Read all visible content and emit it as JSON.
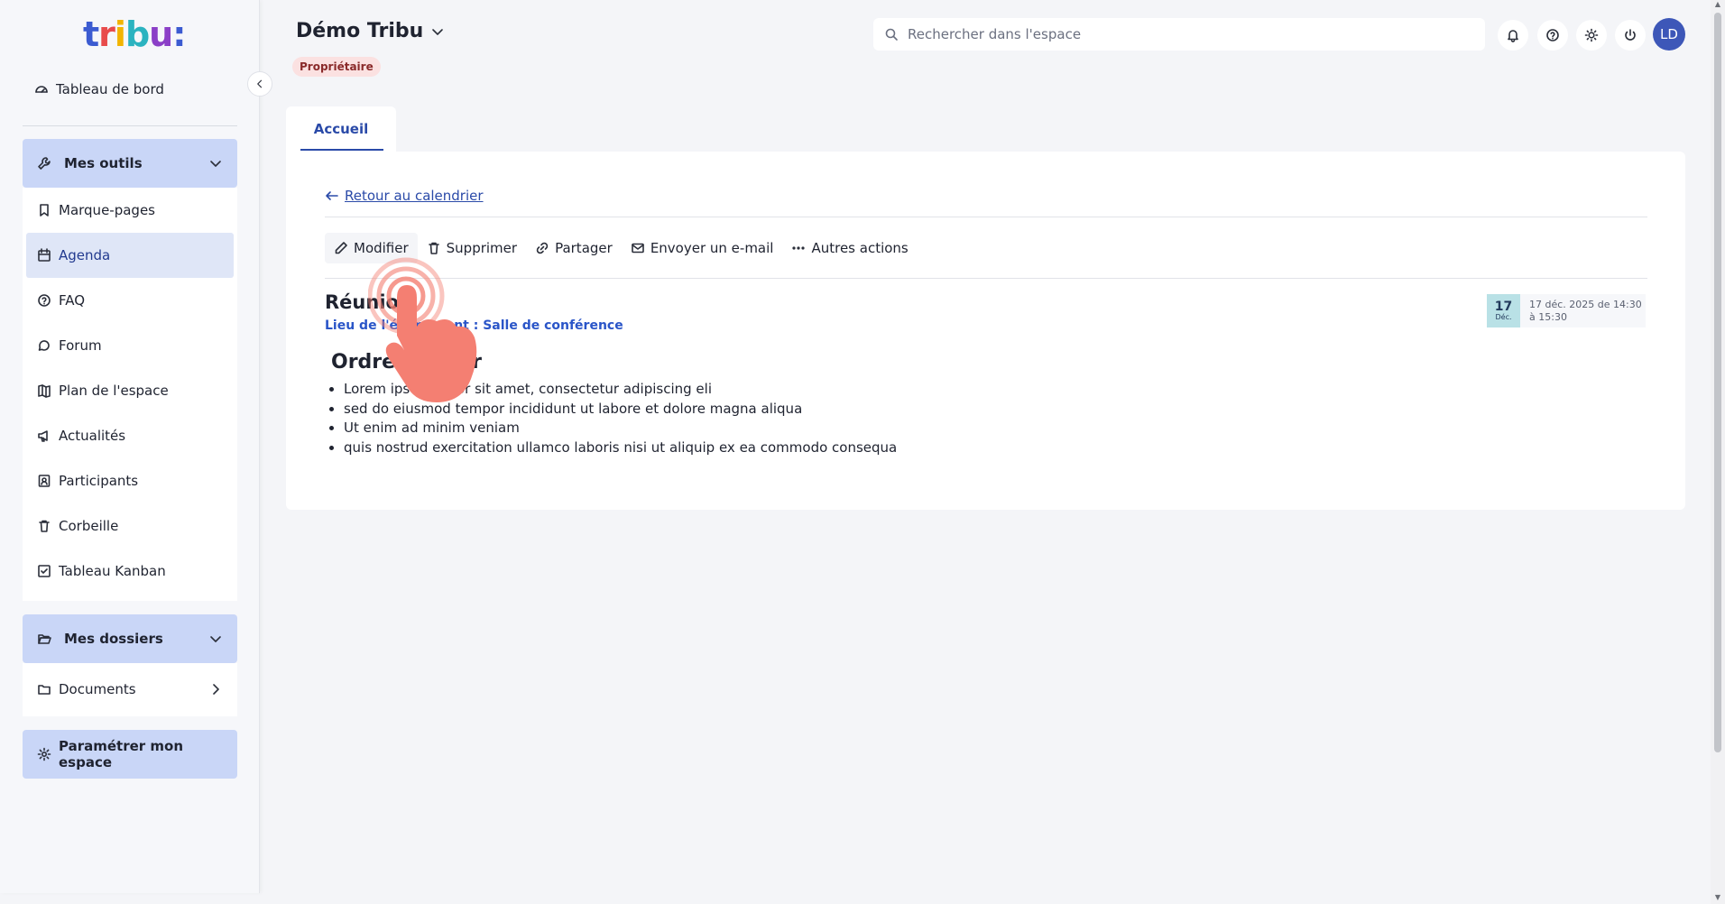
{
  "sidebar": {
    "dashboard_label": "Tableau de bord",
    "tools": {
      "header": "Mes outils",
      "items": [
        {
          "label": "Marque-pages",
          "icon": "bookmark-icon"
        },
        {
          "label": "Agenda",
          "icon": "calendar-icon",
          "active": true
        },
        {
          "label": "FAQ",
          "icon": "help-circle-icon"
        },
        {
          "label": "Forum",
          "icon": "chat-icon"
        },
        {
          "label": "Plan de l'espace",
          "icon": "map-icon"
        },
        {
          "label": "Actualités",
          "icon": "megaphone-icon"
        },
        {
          "label": "Participants",
          "icon": "contact-icon"
        },
        {
          "label": "Corbeille",
          "icon": "trash-icon"
        },
        {
          "label": "Tableau Kanban",
          "icon": "check-square-icon"
        }
      ]
    },
    "folders": {
      "header": "Mes dossiers",
      "items": [
        {
          "label": "Documents",
          "icon": "folder-icon"
        }
      ]
    },
    "settings_label": "Paramétrer mon espace"
  },
  "header": {
    "space_title": "Démo Tribu",
    "role_badge": "Propriétaire",
    "search_placeholder": "Rechercher dans l'espace",
    "avatar_initials": "LD"
  },
  "tabs": [
    {
      "label": "Accueil",
      "active": true
    }
  ],
  "event": {
    "back_link": "Retour au calendrier",
    "actions": [
      {
        "label": "Modifier",
        "icon": "pencil-icon"
      },
      {
        "label": "Supprimer",
        "icon": "trash-icon"
      },
      {
        "label": "Partager",
        "icon": "link-icon"
      },
      {
        "label": "Envoyer un e-mail",
        "icon": "mail-icon"
      },
      {
        "label": "Autres actions",
        "icon": "more-dots-icon"
      }
    ],
    "title": "Réunion",
    "location": "Lieu de l'événement : Salle de conférence",
    "date_day": "17",
    "date_month": "Déc.",
    "date_text": "17 déc. 2025 de 14:30 à 15:30",
    "agenda_title": "Ordre du jour",
    "agenda_items": [
      "Lorem ipsum dolor sit amet, consectetur adipiscing eli",
      "sed do eiusmod tempor incididunt ut labore et dolore magna aliqua",
      "Ut enim ad minim veniam",
      "quis nostrud exercitation ullamco laboris nisi ut aliquip ex ea commodo consequa"
    ]
  },
  "colors": {
    "accent": "#2a4aa8",
    "sidebar_group_bg": "#c9d6f7",
    "badge_bg": "#fbe1e1",
    "date_chip_bg": "#b9e1e6",
    "pointer": "#f47f72"
  }
}
